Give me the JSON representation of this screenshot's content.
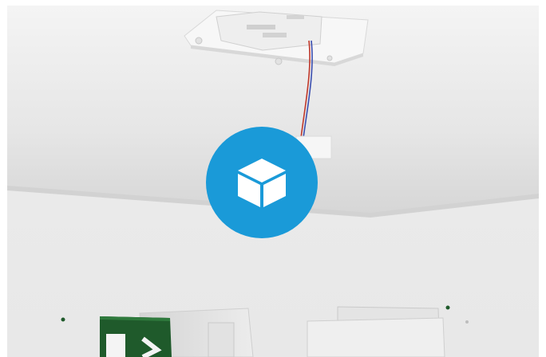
{
  "viewer": {
    "description_hidden": "",
    "colors": {
      "ceiling_light": "#f2f2f2",
      "ceiling_shadow": "#d8d8d8",
      "wall": "#ececec",
      "accent": "#1a9ad8",
      "sign_green": "#1f5a2b",
      "wire_red": "#c0392b",
      "wire_blue": "#3b4fb0"
    },
    "load_button": {
      "icon": "cube-icon",
      "color": "#1a9ad8"
    }
  }
}
